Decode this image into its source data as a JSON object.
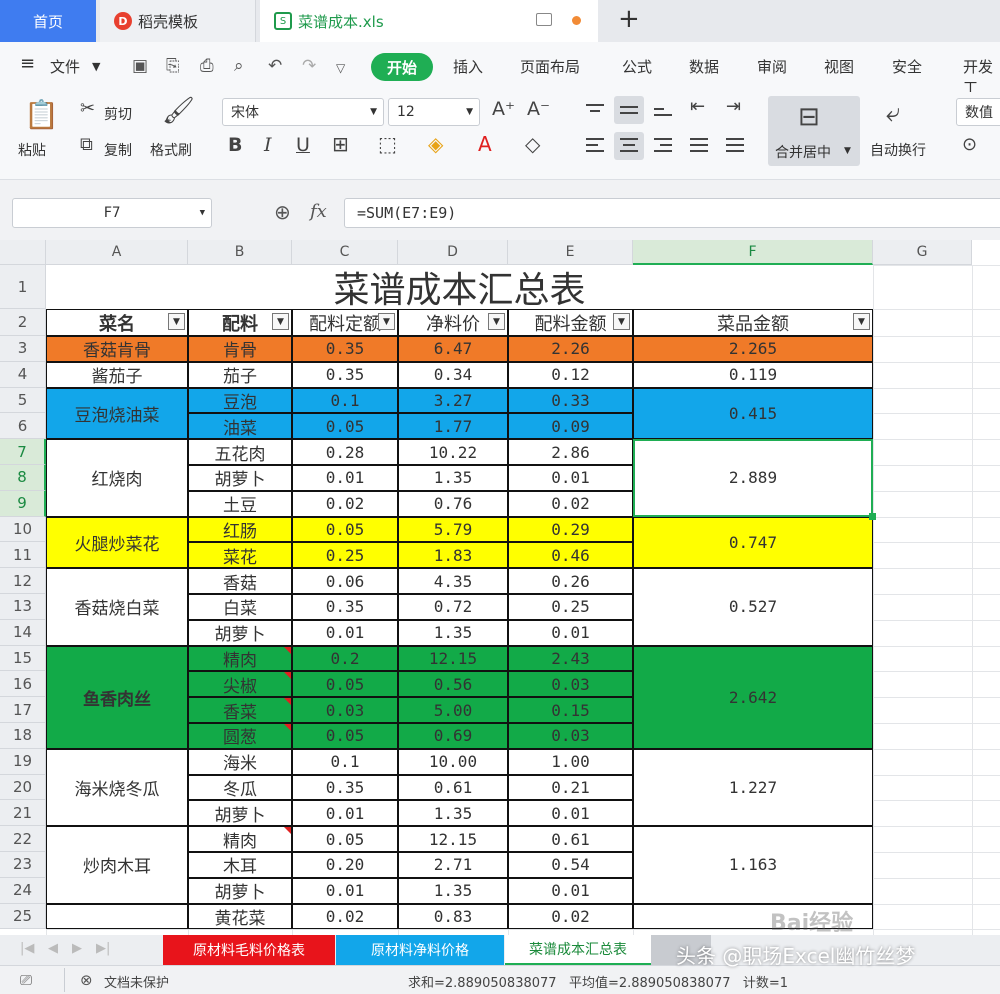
{
  "tabs": {
    "home": "首页",
    "template": "稻壳模板",
    "file": "菜谱成本.xls",
    "template_logo": "D",
    "file_logo": "S"
  },
  "menu": {
    "file_label": "文件",
    "items": [
      "开始",
      "插入",
      "页面布局",
      "公式",
      "数据",
      "审阅",
      "视图",
      "安全",
      "开发工"
    ]
  },
  "ribbon": {
    "paste": "粘贴",
    "cut": "剪切",
    "copy": "复制",
    "format_painter": "格式刷",
    "font_name": "宋体",
    "font_size": "12",
    "merge_center": "合并居中",
    "wrap_text": "自动换行",
    "number_format": "数值"
  },
  "formula_bar": {
    "cell_ref": "F7",
    "fx": "fx",
    "formula": "=SUM(E7:E9)"
  },
  "columns": [
    "A",
    "B",
    "C",
    "D",
    "E",
    "F",
    "G"
  ],
  "rows": [
    "1",
    "2",
    "3",
    "4",
    "5",
    "6",
    "7",
    "8",
    "9",
    "10",
    "11",
    "12",
    "13",
    "14",
    "15",
    "16",
    "17",
    "18",
    "19",
    "20",
    "21",
    "22",
    "23",
    "24",
    "25"
  ],
  "sheet": {
    "title": "菜谱成本汇总表",
    "headers": [
      "菜名",
      "配料",
      "配料定额",
      "净料价",
      "配料金额",
      "菜品金额"
    ],
    "dishes": [
      {
        "name": "香菇肯骨",
        "total": "2.265",
        "fill": "#f07a28",
        "items": [
          [
            "肯骨",
            "0.35",
            "6.47",
            "2.26"
          ]
        ]
      },
      {
        "name": "酱茄子",
        "total": "0.119",
        "fill": "#ffffff",
        "items": [
          [
            "茄子",
            "0.35",
            "0.34",
            "0.12"
          ]
        ]
      },
      {
        "name": "豆泡烧油菜",
        "total": "0.415",
        "fill": "#12a6ea",
        "items": [
          [
            "豆泡",
            "0.1",
            "3.27",
            "0.33"
          ],
          [
            "油菜",
            "0.05",
            "1.77",
            "0.09"
          ]
        ]
      },
      {
        "name": "红烧肉",
        "total": "2.889",
        "fill": "#ffffff",
        "items": [
          [
            "五花肉",
            "0.28",
            "10.22",
            "2.86"
          ],
          [
            "胡萝卜",
            "0.01",
            "1.35",
            "0.01"
          ],
          [
            "土豆",
            "0.02",
            "0.76",
            "0.02"
          ]
        ]
      },
      {
        "name": "火腿炒菜花",
        "total": "0.747",
        "fill": "#ffff00",
        "items": [
          [
            "红肠",
            "0.05",
            "5.79",
            "0.29"
          ],
          [
            "菜花",
            "0.25",
            "1.83",
            "0.46"
          ]
        ]
      },
      {
        "name": "香菇烧白菜",
        "total": "0.527",
        "fill": "#ffffff",
        "items": [
          [
            "香菇",
            "0.06",
            "4.35",
            "0.26"
          ],
          [
            "白菜",
            "0.35",
            "0.72",
            "0.25"
          ],
          [
            "胡萝卜",
            "0.01",
            "1.35",
            "0.01"
          ]
        ]
      },
      {
        "name": "鱼香肉丝",
        "total": "2.642",
        "fill": "#12aa48",
        "items": [
          [
            "精肉",
            "0.2",
            "12.15",
            "2.43"
          ],
          [
            "尖椒",
            "0.05",
            "0.56",
            "0.03"
          ],
          [
            "香菜",
            "0.03",
            "5.00",
            "0.15"
          ],
          [
            "圆葱",
            "0.05",
            "0.69",
            "0.03"
          ]
        ]
      },
      {
        "name": "海米烧冬瓜",
        "total": "1.227",
        "fill": "#ffffff",
        "items": [
          [
            "海米",
            "0.1",
            "10.00",
            "1.00"
          ],
          [
            "冬瓜",
            "0.35",
            "0.61",
            "0.21"
          ],
          [
            "胡萝卜",
            "0.01",
            "1.35",
            "0.01"
          ]
        ]
      },
      {
        "name": "炒肉木耳",
        "total": "1.163",
        "fill": "#ffffff",
        "items": [
          [
            "精肉",
            "0.05",
            "12.15",
            "0.61"
          ],
          [
            "木耳",
            "0.20",
            "2.71",
            "0.54"
          ],
          [
            "胡萝卜",
            "0.01",
            "1.35",
            "0.01"
          ]
        ]
      },
      {
        "name": "",
        "total": "",
        "fill": "#ffffff",
        "items": [
          [
            "黄花菜",
            "0.02",
            "0.83",
            "0.02"
          ]
        ]
      }
    ]
  },
  "sheet_tabs": [
    {
      "label": "原材料毛料价格表",
      "bg": "#e8141b",
      "fg": "#ffffff"
    },
    {
      "label": "原材料净料价格",
      "bg": "#12a6ea",
      "fg": "#ffffff"
    },
    {
      "label": "菜谱成本汇总表",
      "bg": "#ffffff",
      "fg": "#1a8a3a"
    }
  ],
  "status": {
    "protect": "文档未保护",
    "stats": "求和=2.889050838077   平均值=2.889050838077   计数=1"
  },
  "watermark": "头条 @职场Excel幽竹丝梦",
  "baidu_mark": "Bai经验"
}
